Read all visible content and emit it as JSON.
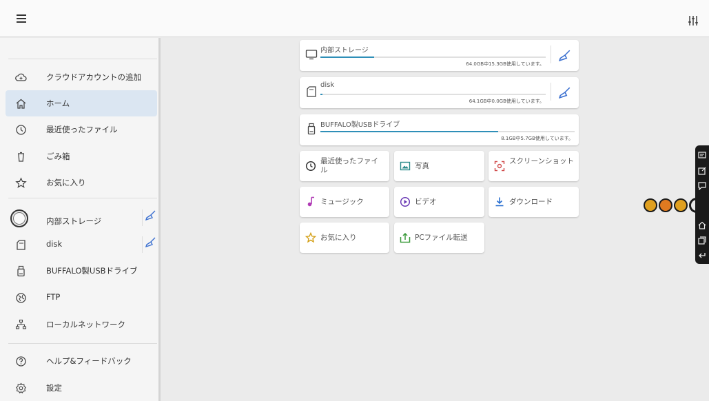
{
  "colors": {
    "accent": "#2f8fb8",
    "active_bg": "#dbe6f2",
    "clean_icon": "#3a6fd0"
  },
  "sidebar": {
    "items": [
      {
        "label": "クラウドアカウントの追加",
        "icon": "cloud-add-icon"
      },
      {
        "label": "ホーム",
        "icon": "home-icon"
      },
      {
        "label": "最近使ったファイル",
        "icon": "clock-icon"
      },
      {
        "label": "ごみ箱",
        "icon": "trash-icon"
      },
      {
        "label": "お気に入り",
        "icon": "star-icon"
      },
      {
        "label": "内部ストレージ",
        "icon": "internal-storage-icon"
      },
      {
        "label": "disk",
        "icon": "sd-card-icon"
      },
      {
        "label": "BUFFALO製USBドライブ",
        "icon": "usb-drive-icon"
      },
      {
        "label": "FTP",
        "icon": "globe-icon"
      },
      {
        "label": "ローカルネットワーク",
        "icon": "network-icon"
      },
      {
        "label": "ヘルプ&フィードバック",
        "icon": "help-icon"
      },
      {
        "label": "設定",
        "icon": "gear-icon"
      }
    ]
  },
  "storage": [
    {
      "name": "内部ストレージ",
      "usage": "64.0GB中15.3GB使用しています。",
      "used_fraction": 0.24,
      "icon": "monitor-icon"
    },
    {
      "name": "disk",
      "usage": "64.1GB中0.0GB使用しています。",
      "used_fraction": 0.01,
      "icon": "sd-card-icon"
    },
    {
      "name": "BUFFALO製USBドライブ",
      "usage": "8.1GB中5.7GB使用しています。",
      "used_fraction": 0.7,
      "icon": "usb-drive-icon"
    }
  ],
  "tiles": {
    "recent": "最近使ったファイル",
    "photos": "写真",
    "screenshots": "スクリーンショット",
    "music": "ミュージック",
    "video": "ビデオ",
    "downloads": "ダウンロード",
    "favorites": "お気に入り",
    "pc_transfer": "PCファイル転送"
  }
}
